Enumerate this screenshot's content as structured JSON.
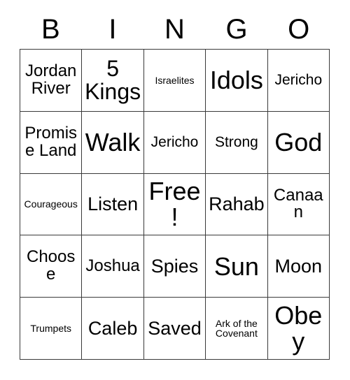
{
  "card": {
    "type": "bingo-card",
    "columns": 5,
    "rows": 5,
    "header_letters": [
      "B",
      "I",
      "N",
      "G",
      "O"
    ],
    "border_color": "#3a3a3a",
    "background_color": "#ffffff",
    "text_color": "#000000",
    "cells": [
      [
        {
          "label": "Jordan River",
          "size": "md"
        },
        {
          "label": "5 Kings",
          "size": "xl"
        },
        {
          "label": "Israelites",
          "size": "xs"
        },
        {
          "label": "Idols",
          "size": "xxl"
        },
        {
          "label": "Jericho",
          "size": "sm"
        }
      ],
      [
        {
          "label": "Promise Land",
          "size": "md"
        },
        {
          "label": "Walk",
          "size": "xxl"
        },
        {
          "label": "Jericho",
          "size": "sm"
        },
        {
          "label": "Strong",
          "size": "sm"
        },
        {
          "label": "God",
          "size": "xxl"
        }
      ],
      [
        {
          "label": "Courageous",
          "size": "xs"
        },
        {
          "label": "Listen",
          "size": "lg"
        },
        {
          "label": "Free!",
          "size": "xxl"
        },
        {
          "label": "Rahab",
          "size": "lg"
        },
        {
          "label": "Canaan",
          "size": "md"
        }
      ],
      [
        {
          "label": "Choose",
          "size": "md"
        },
        {
          "label": "Joshua",
          "size": "md"
        },
        {
          "label": "Spies",
          "size": "lg"
        },
        {
          "label": "Sun",
          "size": "xxl"
        },
        {
          "label": "Moon",
          "size": "lg"
        }
      ],
      [
        {
          "label": "Trumpets",
          "size": "xs"
        },
        {
          "label": "Caleb",
          "size": "lg"
        },
        {
          "label": "Saved",
          "size": "lg"
        },
        {
          "label": "Ark of the Covenant",
          "size": "xs"
        },
        {
          "label": "Obey",
          "size": "xxl"
        }
      ]
    ]
  }
}
